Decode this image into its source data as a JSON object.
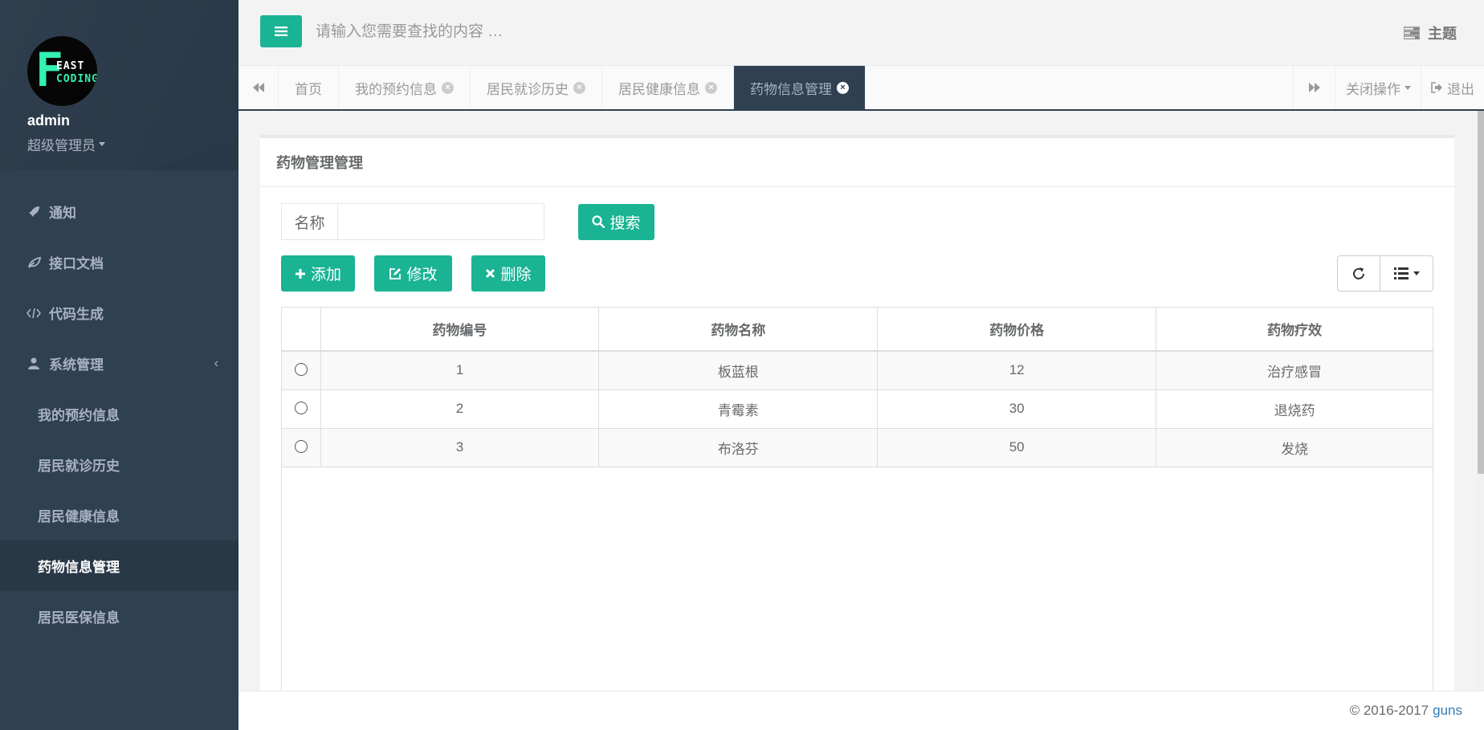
{
  "sidebar": {
    "logo_big": "F",
    "logo_line1": "EAST",
    "logo_line2": "CODING",
    "user_name": "admin",
    "user_role": "超级管理员",
    "menu": [
      {
        "label": "通知",
        "icon": "rocket-icon"
      },
      {
        "label": "接口文档",
        "icon": "leaf-icon"
      },
      {
        "label": "代码生成",
        "icon": "code-icon"
      },
      {
        "label": "系统管理",
        "icon": "user-icon"
      }
    ],
    "submenu": [
      {
        "label": "我的预约信息"
      },
      {
        "label": "居民就诊历史"
      },
      {
        "label": "居民健康信息"
      },
      {
        "label": "药物信息管理",
        "active": true
      },
      {
        "label": "居民医保信息"
      }
    ]
  },
  "topbar": {
    "search_placeholder": "请输入您需要查找的内容 …",
    "theme_label": "主题"
  },
  "tabs": {
    "items": [
      {
        "label": "首页"
      },
      {
        "label": "我的预约信息"
      },
      {
        "label": "居民就诊历史"
      },
      {
        "label": "居民健康信息"
      },
      {
        "label": "药物信息管理",
        "active": true
      }
    ],
    "close_ops_label": "关闭操作",
    "logout_label": "退出"
  },
  "panel": {
    "title": "药物管理管理",
    "search_label": "名称",
    "search_value": "",
    "search_button": "搜索",
    "add_button": "添加",
    "edit_button": "修改",
    "delete_button": "删除"
  },
  "table": {
    "columns": [
      "药物编号",
      "药物名称",
      "药物价格",
      "药物疗效"
    ],
    "rows": [
      [
        "1",
        "板蓝根",
        "12",
        "治疗感冒"
      ],
      [
        "2",
        "青霉素",
        "30",
        "退烧药"
      ],
      [
        "3",
        "布洛芬",
        "50",
        "发烧"
      ]
    ]
  },
  "footer": {
    "copyright": "© 2016-2017",
    "link": "guns"
  },
  "colors": {
    "accent": "#1ab394",
    "sidebar_bg": "#2f4050",
    "link": "#337ab7"
  }
}
